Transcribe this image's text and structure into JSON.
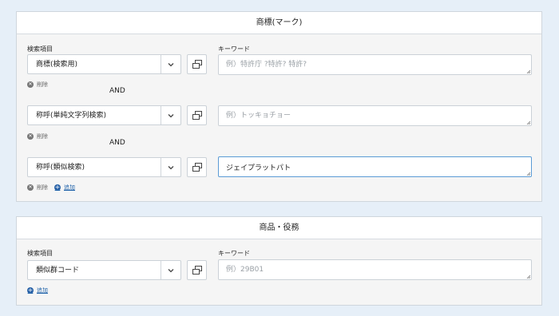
{
  "trademark_section": {
    "title": "商標(マーク)",
    "field_label": "検索項目",
    "keyword_label": "キーワード",
    "rows": [
      {
        "field": "商標(検索用)",
        "keyword_value": "",
        "placeholder": "例）特許庁 ?特許? 特許?"
      },
      {
        "field": "称呼(単純文字列検索)",
        "keyword_value": "",
        "placeholder": "例）トッキョチョー"
      },
      {
        "field": "称呼(類似検索)",
        "keyword_value": "ジェイプラットパト",
        "placeholder": ""
      }
    ],
    "connector": "AND",
    "delete_label": "削除",
    "add_label": "追加"
  },
  "goods_section": {
    "title": "商品・役務",
    "field_label": "検索項目",
    "keyword_label": "キーワード",
    "rows": [
      {
        "field": "類似群コード",
        "keyword_value": "",
        "placeholder": "例）29B01"
      }
    ],
    "add_label": "追加"
  },
  "icons": {
    "dropdown": "chevron-down-icon",
    "copy": "copy-icon",
    "delete": "delete-circle-icon",
    "add": "add-circle-icon"
  },
  "colors": {
    "page_bg": "#e6eff8",
    "panel_bg": "#f5f5f5",
    "link": "#1b5fa8",
    "focus_border": "#5b9bd5"
  }
}
